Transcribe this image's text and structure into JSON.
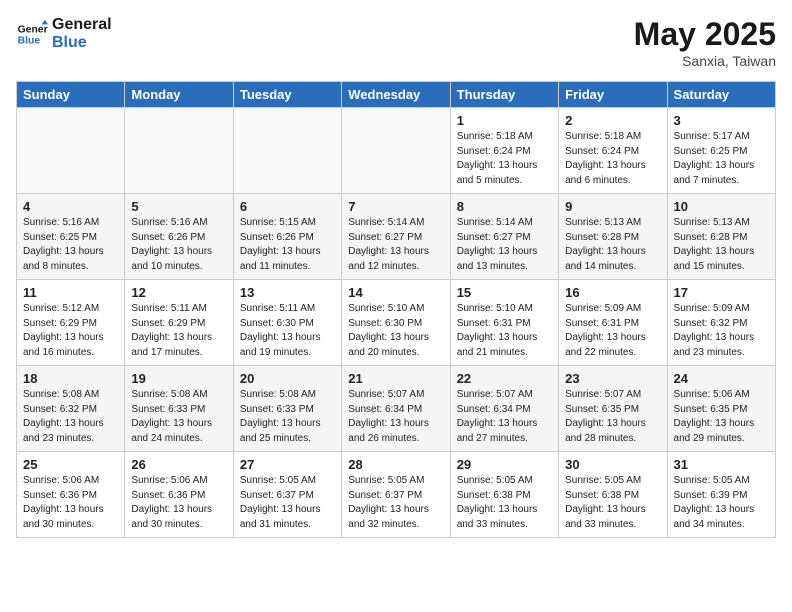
{
  "header": {
    "logo_line1": "General",
    "logo_line2": "Blue",
    "month": "May 2025",
    "location": "Sanxia, Taiwan"
  },
  "weekdays": [
    "Sunday",
    "Monday",
    "Tuesday",
    "Wednesday",
    "Thursday",
    "Friday",
    "Saturday"
  ],
  "weeks": [
    [
      {
        "day": "",
        "info": ""
      },
      {
        "day": "",
        "info": ""
      },
      {
        "day": "",
        "info": ""
      },
      {
        "day": "",
        "info": ""
      },
      {
        "day": "1",
        "info": "Sunrise: 5:18 AM\nSunset: 6:24 PM\nDaylight: 13 hours\nand 5 minutes."
      },
      {
        "day": "2",
        "info": "Sunrise: 5:18 AM\nSunset: 6:24 PM\nDaylight: 13 hours\nand 6 minutes."
      },
      {
        "day": "3",
        "info": "Sunrise: 5:17 AM\nSunset: 6:25 PM\nDaylight: 13 hours\nand 7 minutes."
      }
    ],
    [
      {
        "day": "4",
        "info": "Sunrise: 5:16 AM\nSunset: 6:25 PM\nDaylight: 13 hours\nand 8 minutes."
      },
      {
        "day": "5",
        "info": "Sunrise: 5:16 AM\nSunset: 6:26 PM\nDaylight: 13 hours\nand 10 minutes."
      },
      {
        "day": "6",
        "info": "Sunrise: 5:15 AM\nSunset: 6:26 PM\nDaylight: 13 hours\nand 11 minutes."
      },
      {
        "day": "7",
        "info": "Sunrise: 5:14 AM\nSunset: 6:27 PM\nDaylight: 13 hours\nand 12 minutes."
      },
      {
        "day": "8",
        "info": "Sunrise: 5:14 AM\nSunset: 6:27 PM\nDaylight: 13 hours\nand 13 minutes."
      },
      {
        "day": "9",
        "info": "Sunrise: 5:13 AM\nSunset: 6:28 PM\nDaylight: 13 hours\nand 14 minutes."
      },
      {
        "day": "10",
        "info": "Sunrise: 5:13 AM\nSunset: 6:28 PM\nDaylight: 13 hours\nand 15 minutes."
      }
    ],
    [
      {
        "day": "11",
        "info": "Sunrise: 5:12 AM\nSunset: 6:29 PM\nDaylight: 13 hours\nand 16 minutes."
      },
      {
        "day": "12",
        "info": "Sunrise: 5:11 AM\nSunset: 6:29 PM\nDaylight: 13 hours\nand 17 minutes."
      },
      {
        "day": "13",
        "info": "Sunrise: 5:11 AM\nSunset: 6:30 PM\nDaylight: 13 hours\nand 19 minutes."
      },
      {
        "day": "14",
        "info": "Sunrise: 5:10 AM\nSunset: 6:30 PM\nDaylight: 13 hours\nand 20 minutes."
      },
      {
        "day": "15",
        "info": "Sunrise: 5:10 AM\nSunset: 6:31 PM\nDaylight: 13 hours\nand 21 minutes."
      },
      {
        "day": "16",
        "info": "Sunrise: 5:09 AM\nSunset: 6:31 PM\nDaylight: 13 hours\nand 22 minutes."
      },
      {
        "day": "17",
        "info": "Sunrise: 5:09 AM\nSunset: 6:32 PM\nDaylight: 13 hours\nand 23 minutes."
      }
    ],
    [
      {
        "day": "18",
        "info": "Sunrise: 5:08 AM\nSunset: 6:32 PM\nDaylight: 13 hours\nand 23 minutes."
      },
      {
        "day": "19",
        "info": "Sunrise: 5:08 AM\nSunset: 6:33 PM\nDaylight: 13 hours\nand 24 minutes."
      },
      {
        "day": "20",
        "info": "Sunrise: 5:08 AM\nSunset: 6:33 PM\nDaylight: 13 hours\nand 25 minutes."
      },
      {
        "day": "21",
        "info": "Sunrise: 5:07 AM\nSunset: 6:34 PM\nDaylight: 13 hours\nand 26 minutes."
      },
      {
        "day": "22",
        "info": "Sunrise: 5:07 AM\nSunset: 6:34 PM\nDaylight: 13 hours\nand 27 minutes."
      },
      {
        "day": "23",
        "info": "Sunrise: 5:07 AM\nSunset: 6:35 PM\nDaylight: 13 hours\nand 28 minutes."
      },
      {
        "day": "24",
        "info": "Sunrise: 5:06 AM\nSunset: 6:35 PM\nDaylight: 13 hours\nand 29 minutes."
      }
    ],
    [
      {
        "day": "25",
        "info": "Sunrise: 5:06 AM\nSunset: 6:36 PM\nDaylight: 13 hours\nand 30 minutes."
      },
      {
        "day": "26",
        "info": "Sunrise: 5:06 AM\nSunset: 6:36 PM\nDaylight: 13 hours\nand 30 minutes."
      },
      {
        "day": "27",
        "info": "Sunrise: 5:05 AM\nSunset: 6:37 PM\nDaylight: 13 hours\nand 31 minutes."
      },
      {
        "day": "28",
        "info": "Sunrise: 5:05 AM\nSunset: 6:37 PM\nDaylight: 13 hours\nand 32 minutes."
      },
      {
        "day": "29",
        "info": "Sunrise: 5:05 AM\nSunset: 6:38 PM\nDaylight: 13 hours\nand 33 minutes."
      },
      {
        "day": "30",
        "info": "Sunrise: 5:05 AM\nSunset: 6:38 PM\nDaylight: 13 hours\nand 33 minutes."
      },
      {
        "day": "31",
        "info": "Sunrise: 5:05 AM\nSunset: 6:39 PM\nDaylight: 13 hours\nand 34 minutes."
      }
    ]
  ]
}
